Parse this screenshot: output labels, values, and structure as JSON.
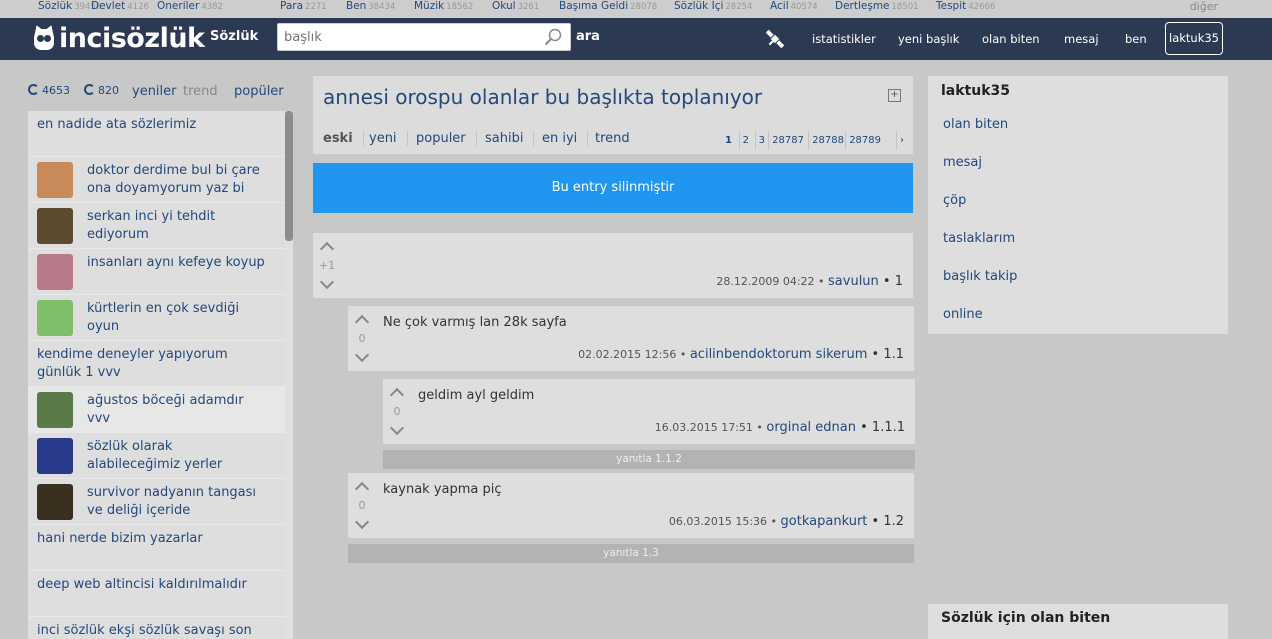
{
  "category_bar": {
    "items": [
      {
        "label": "Sözlük",
        "count": "39456"
      },
      {
        "label": "Devlet",
        "count": "4126"
      },
      {
        "label": "Oneriler",
        "count": "4382"
      },
      {
        "label": "Para",
        "count": "2271"
      },
      {
        "label": "Ben",
        "count": "38434"
      },
      {
        "label": "Müzik",
        "count": "18562"
      },
      {
        "label": "Okul",
        "count": "3261"
      },
      {
        "label": "Başıma Geldi",
        "count": "28078"
      },
      {
        "label": "Sözlük İçi",
        "count": "28254"
      },
      {
        "label": "Acil",
        "count": "40574"
      },
      {
        "label": "Dertleşme",
        "count": "18501"
      },
      {
        "label": "Tespit",
        "count": "42666"
      }
    ],
    "other": "diğer"
  },
  "header": {
    "logo": "incisözlük",
    "nav_sozluk": "Sözlük",
    "search_placeholder": "başlık",
    "search_button": "ara",
    "nav": [
      "istatistikler",
      "yeni başlık",
      "olan biten",
      "mesaj",
      "ben"
    ],
    "user": "laktuk35"
  },
  "left": {
    "tabs": {
      "count1": "4653",
      "count2": "820",
      "new": "yeniler",
      "trend": "trend",
      "popular": "popüler"
    },
    "items": [
      {
        "title": "en nadide ata sözlerimiz",
        "thumb": false
      },
      {
        "title": "doktor derdime bul bi çare ona doyamyorum yaz bi",
        "thumb": true,
        "color": "#c98a5a"
      },
      {
        "title": "serkan inci yi tehdit ediyorum",
        "thumb": true,
        "color": "#5a4a30"
      },
      {
        "title": "insanları aynı kefeye koyup",
        "thumb": true,
        "color": "#b77a8a"
      },
      {
        "title": "kürtlerin en çok sevdiği oyun",
        "thumb": true,
        "color": "#7fbf6a"
      },
      {
        "title": "kendime deneyler yapıyorum günlük 1 vvv",
        "thumb": false
      },
      {
        "title": "ağustos böceği adamdır vvv",
        "thumb": true,
        "color": "#5a7a4a",
        "active": true
      },
      {
        "title": "sözlük olarak alabileceğimiz yerler",
        "thumb": true,
        "color": "#2a3a8a"
      },
      {
        "title": "survivor nadyanın tangası ve deliği içeride",
        "thumb": true,
        "color": "#3a3020"
      },
      {
        "title": "hani nerde bizim yazarlar",
        "thumb": false
      },
      {
        "title": "deep web altincisi kaldırılmalıdır",
        "thumb": false
      },
      {
        "title": "inci sözlük ekşi sözlük savaşı son",
        "thumb": false
      }
    ]
  },
  "topic": {
    "title": "annesi orospu olanlar bu başlıkta toplanıyor",
    "sort_tabs": [
      "eski",
      "yeni",
      "populer",
      "sahibi",
      "en iyi",
      "trend"
    ],
    "pages": [
      "1",
      "2",
      "3",
      "28787",
      "28788",
      "28789",
      "›"
    ],
    "deleted_text": "Bu entry silinmiştir"
  },
  "entries": [
    {
      "score": "+1",
      "content": "",
      "date": "28.12.2009 04:22",
      "author": "savulun",
      "idx": "1"
    },
    {
      "score": "0",
      "content": "Ne çok varmış lan 28k sayfa",
      "date": "02.02.2015 12:56",
      "author": "acilinbendoktorum sikerum",
      "idx": "1.1"
    },
    {
      "score": "0",
      "content": "geldim ayl geldim",
      "date": "16.03.2015 17:51",
      "author": "orginal ednan",
      "idx": "1.1.1"
    },
    {
      "score": "0",
      "content": "kaynak yapma piç",
      "date": "06.03.2015 15:36",
      "author": "gotkapankurt",
      "idx": "1.2"
    }
  ],
  "replies": {
    "r1": "yanıtla 1.1.2",
    "r2": "yanıtla 1.3"
  },
  "right": {
    "user": "laktuk35",
    "items": [
      "olan biten",
      "mesaj",
      "çöp",
      "taslaklarım",
      "başlık takip",
      "online"
    ],
    "box2_title": "Sözlük için olan biten"
  },
  "colors": {
    "header_bg": "#2b3953",
    "link": "#23487c",
    "banner": "#2196f0"
  }
}
